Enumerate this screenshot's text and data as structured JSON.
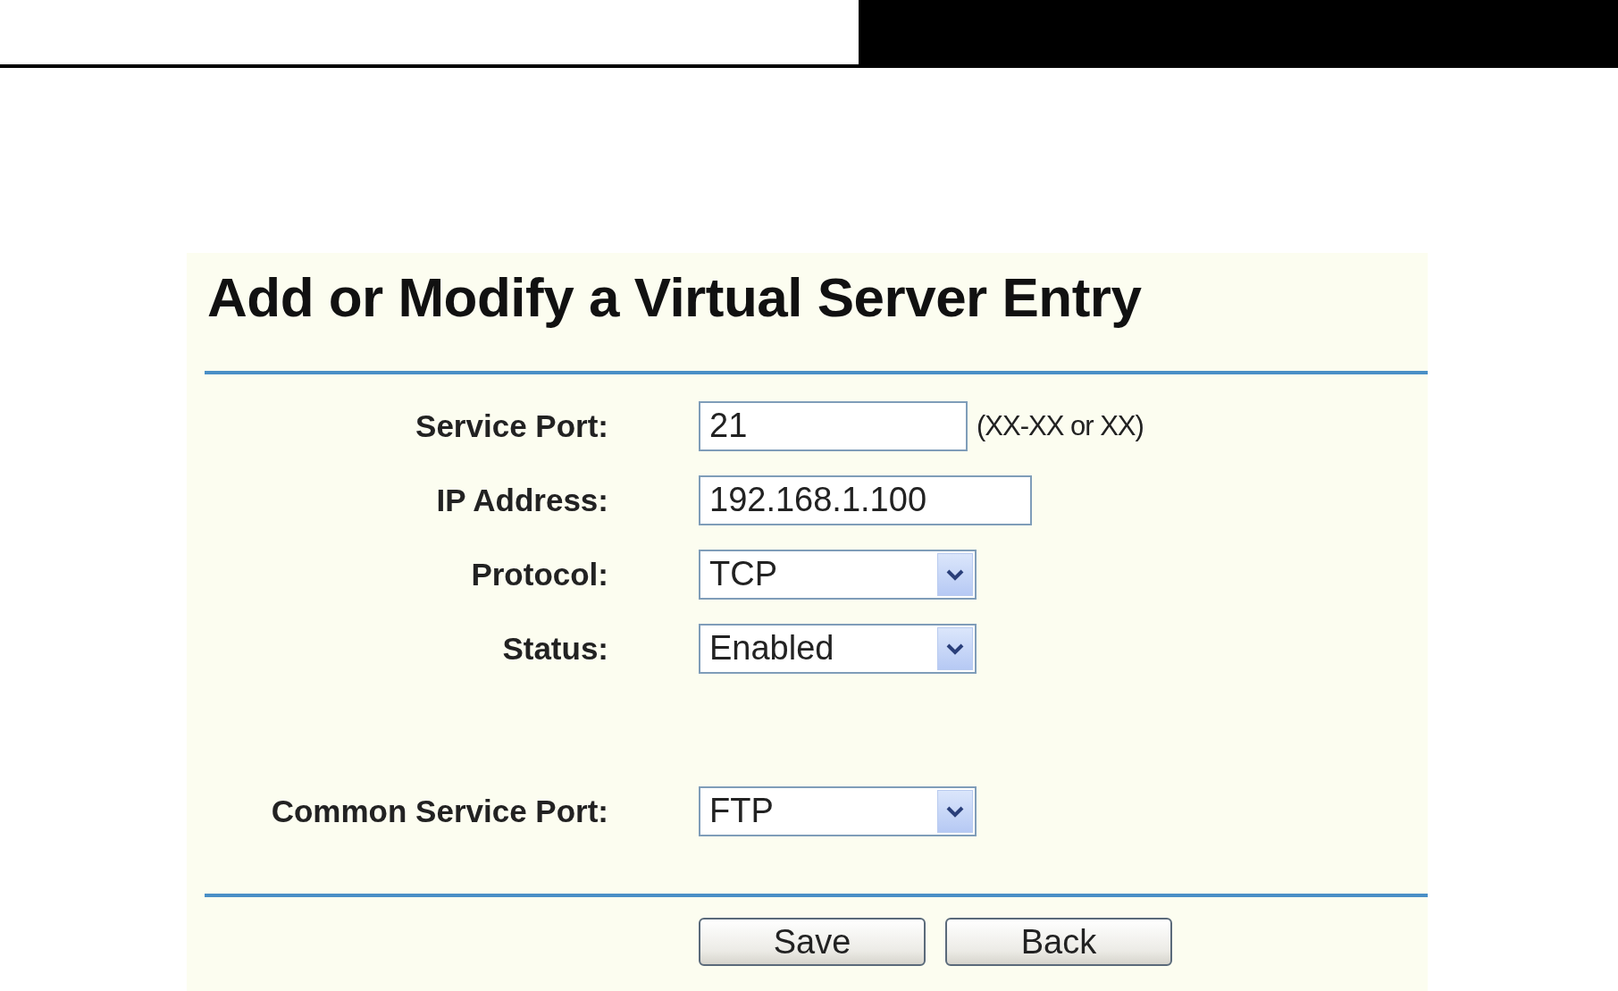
{
  "title": "Add or Modify a Virtual Server Entry",
  "fields": [
    {
      "label": "Service Port:",
      "kind": "text",
      "value": "21",
      "hint": "(XX-XX or XX)"
    },
    {
      "label": "IP Address:",
      "kind": "text",
      "value": "192.168.1.100"
    },
    {
      "label": "Protocol:",
      "kind": "select",
      "value": "TCP"
    },
    {
      "label": "Status:",
      "kind": "select",
      "value": "Enabled"
    }
  ],
  "common_service_port": {
    "label": "Common Service Port:",
    "kind": "select",
    "value": "FTP"
  },
  "buttons": [
    "Save",
    "Back"
  ]
}
